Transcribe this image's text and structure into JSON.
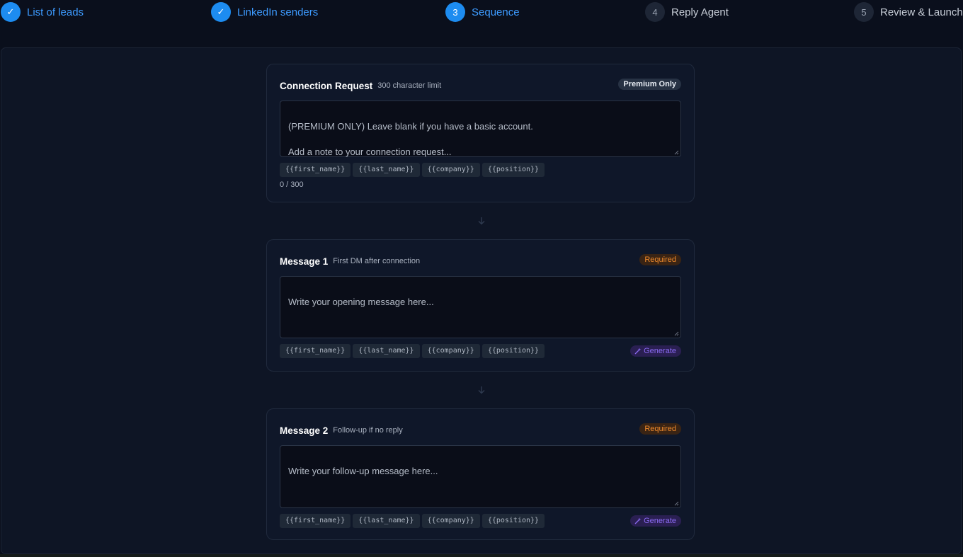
{
  "stepper": {
    "steps": [
      {
        "marker": "✓",
        "label": "List of leads",
        "state": "done"
      },
      {
        "marker": "✓",
        "label": "LinkedIn senders",
        "state": "done"
      },
      {
        "marker": "3",
        "label": "Sequence",
        "state": "active"
      },
      {
        "marker": "4",
        "label": "Reply Agent",
        "state": "todo"
      },
      {
        "marker": "5",
        "label": "Review & Launch",
        "state": "todo"
      }
    ]
  },
  "tokens": [
    "{{first_name}}",
    "{{last_name}}",
    "{{company}}",
    "{{position}}"
  ],
  "connection": {
    "title": "Connection Request",
    "subtitle": "300 character limit",
    "badge": "Premium Only",
    "placeholder": "(PREMIUM ONLY) Leave blank if you have a basic account.\n\nAdd a note to your connection request...",
    "counter": "0 / 300"
  },
  "message1": {
    "title": "Message 1",
    "subtitle": "First DM after connection",
    "badge": "Required",
    "placeholder": "Write your opening message here...",
    "generate_label": "Generate"
  },
  "message2": {
    "title": "Message 2",
    "subtitle": "Follow-up if no reply",
    "badge": "Required",
    "placeholder": "Write your follow-up message here...",
    "generate_label": "Generate"
  },
  "icons": {
    "step_done": "check-icon",
    "connector": "arrow-down-icon",
    "generate": "sparkle-icon",
    "resize": "resize-grip-icon"
  },
  "colors": {
    "accent": "#1d8cf0",
    "required": "#f08a2c",
    "generate": "#8b6bf3",
    "background": "#0a0f1c"
  }
}
